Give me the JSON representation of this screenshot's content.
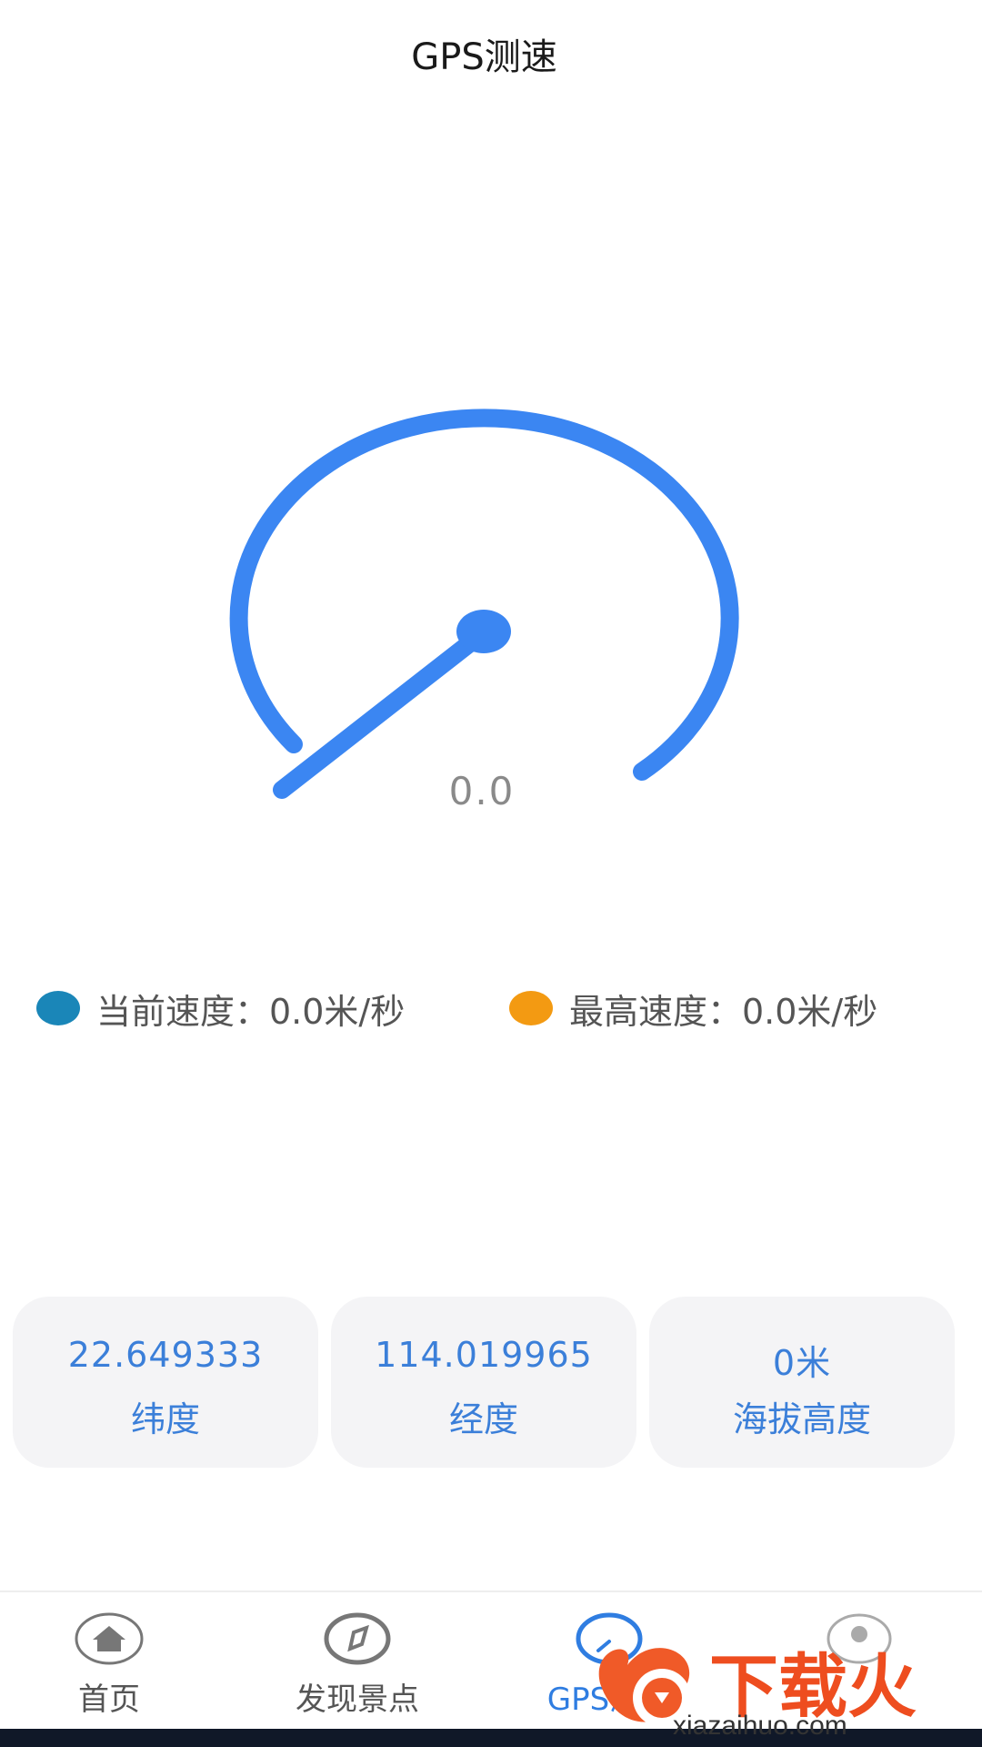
{
  "header": {
    "title": "GPS测速"
  },
  "gauge": {
    "speed_display": "0.0",
    "speed_fraction": 0.0,
    "arc_color": "#3b86f2"
  },
  "legend": {
    "current": {
      "text": "当前速度：0.0米/秒",
      "color": "#1a86b8"
    },
    "max": {
      "text": "最高速度：0.0米/秒",
      "color": "#f39a12"
    }
  },
  "cards": [
    {
      "value": "22.649333",
      "label": "纬度"
    },
    {
      "value": "114.019965",
      "label": "经度"
    },
    {
      "value": "0米",
      "label": "海拔高度"
    }
  ],
  "tabbar": {
    "items": [
      {
        "label": "首页",
        "icon": "home-icon"
      },
      {
        "label": "发现景点",
        "icon": "compass-icon"
      },
      {
        "label": "GPS测速",
        "icon": "speedometer-icon",
        "active": true
      },
      {
        "label": "",
        "icon": "profile-icon"
      }
    ]
  },
  "watermark": {
    "text": "下载火",
    "url": "xiazaihuo.com"
  },
  "colors": {
    "accent": "#2f7de1",
    "card_bg": "#f4f4f6"
  }
}
